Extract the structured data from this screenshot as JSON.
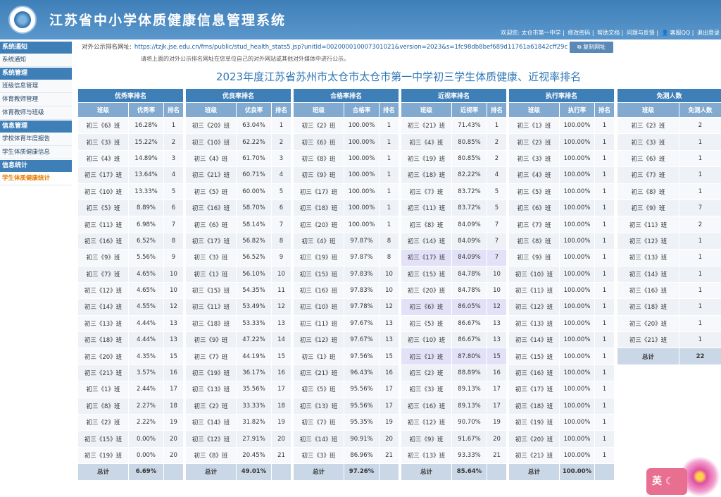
{
  "header": {
    "title": "江苏省中小学体质健康信息管理系统",
    "welcome": "欢迎您: 太仓市第一中学",
    "links": [
      "修改密码",
      "帮助文档",
      "问题与反馈",
      "客服QQ",
      "退出登录"
    ]
  },
  "sidebar": [
    {
      "section": "系统通知",
      "items": [
        "系统通知"
      ]
    },
    {
      "section": "系统管理",
      "items": [
        "班级信息管理",
        "体育教师管理",
        "体育教师与班级"
      ]
    },
    {
      "section": "信息管理",
      "items": [
        "学校体育年度报告",
        "学生体质健康信息"
      ]
    },
    {
      "section": "信息统计",
      "items": [
        "学生体质健康统计"
      ]
    }
  ],
  "active_item": "学生体质健康统计",
  "url_label": "对外公示排名网址:",
  "url": "https://tzjk.jse.edu.cn/fms/public/stud_health_stats5.jsp?unitId=00200001000730102​1&version=2023&s=1fc98db8bef689d11761a61842cff29c",
  "copy_button": "复制网址",
  "note": "请将上面的对外公示排名网址在您单位自己的对外网站或其他对外媒体中进行公示。",
  "page_title": "2023年度江苏省苏州市太仓市太仓市第一中学初三学生体质健康、近视率排名",
  "ime_label": "英",
  "tables": [
    {
      "caption": "优秀率排名",
      "cols": [
        "班级",
        "优秀率",
        "排名"
      ],
      "rows": [
        [
          "初三《6》班",
          "16.28%",
          "1"
        ],
        [
          "初三《3》班",
          "15.22%",
          "2"
        ],
        [
          "初三《4》班",
          "14.89%",
          "3"
        ],
        [
          "初三《17》班",
          "13.64%",
          "4"
        ],
        [
          "初三《10》班",
          "13.33%",
          "5"
        ],
        [
          "初三《5》班",
          "8.89%",
          "6"
        ],
        [
          "初三《11》班",
          "6.98%",
          "7"
        ],
        [
          "初三《16》班",
          "6.52%",
          "8"
        ],
        [
          "初三《9》班",
          "5.56%",
          "9"
        ],
        [
          "初三《7》班",
          "4.65%",
          "10"
        ],
        [
          "初三《12》班",
          "4.65%",
          "10"
        ],
        [
          "初三《14》班",
          "4.55%",
          "12"
        ],
        [
          "初三《13》班",
          "4.44%",
          "13"
        ],
        [
          "初三《18》班",
          "4.44%",
          "13"
        ],
        [
          "初三《20》班",
          "4.35%",
          "15"
        ],
        [
          "初三《21》班",
          "3.57%",
          "16"
        ],
        [
          "初三《1》班",
          "2.44%",
          "17"
        ],
        [
          "初三《8》班",
          "2.27%",
          "18"
        ],
        [
          "初三《2》班",
          "2.22%",
          "19"
        ],
        [
          "初三《15》班",
          "0.00%",
          "20"
        ],
        [
          "初三《19》班",
          "0.00%",
          "20"
        ]
      ],
      "total": [
        "总计",
        "6.69%",
        ""
      ]
    },
    {
      "caption": "优良率排名",
      "cols": [
        "班级",
        "优良率",
        "排名"
      ],
      "rows": [
        [
          "初三《20》班",
          "63.04%",
          "1"
        ],
        [
          "初三《10》班",
          "62.22%",
          "2"
        ],
        [
          "初三《4》班",
          "61.70%",
          "3"
        ],
        [
          "初三《21》班",
          "60.71%",
          "4"
        ],
        [
          "初三《5》班",
          "60.00%",
          "5"
        ],
        [
          "初三《16》班",
          "58.70%",
          "6"
        ],
        [
          "初三《6》班",
          "58.14%",
          "7"
        ],
        [
          "初三《17》班",
          "56.82%",
          "8"
        ],
        [
          "初三《3》班",
          "56.52%",
          "9"
        ],
        [
          "初三《1》班",
          "56.10%",
          "10"
        ],
        [
          "初三《15》班",
          "54.35%",
          "11"
        ],
        [
          "初三《11》班",
          "53.49%",
          "12"
        ],
        [
          "初三《18》班",
          "53.33%",
          "13"
        ],
        [
          "初三《9》班",
          "47.22%",
          "14"
        ],
        [
          "初三《7》班",
          "44.19%",
          "15"
        ],
        [
          "初三《19》班",
          "36.17%",
          "16"
        ],
        [
          "初三《13》班",
          "35.56%",
          "17"
        ],
        [
          "初三《2》班",
          "33.33%",
          "18"
        ],
        [
          "初三《14》班",
          "31.82%",
          "19"
        ],
        [
          "初三《12》班",
          "27.91%",
          "20"
        ],
        [
          "初三《8》班",
          "20.45%",
          "21"
        ]
      ],
      "total": [
        "总计",
        "49.01%",
        ""
      ]
    },
    {
      "caption": "合格率排名",
      "cols": [
        "班级",
        "合格率",
        "排名"
      ],
      "rows": [
        [
          "初三《2》班",
          "100.00%",
          "1"
        ],
        [
          "初三《6》班",
          "100.00%",
          "1"
        ],
        [
          "初三《8》班",
          "100.00%",
          "1"
        ],
        [
          "初三《9》班",
          "100.00%",
          "1"
        ],
        [
          "初三《17》班",
          "100.00%",
          "1"
        ],
        [
          "初三《18》班",
          "100.00%",
          "1"
        ],
        [
          "初三《20》班",
          "100.00%",
          "1"
        ],
        [
          "初三《4》班",
          "97.87%",
          "8"
        ],
        [
          "初三《19》班",
          "97.87%",
          "8"
        ],
        [
          "初三《15》班",
          "97.83%",
          "10"
        ],
        [
          "初三《16》班",
          "97.83%",
          "10"
        ],
        [
          "初三《10》班",
          "97.78%",
          "12"
        ],
        [
          "初三《11》班",
          "97.67%",
          "13"
        ],
        [
          "初三《12》班",
          "97.67%",
          "13"
        ],
        [
          "初三《1》班",
          "97.56%",
          "15"
        ],
        [
          "初三《21》班",
          "96.43%",
          "16"
        ],
        [
          "初三《5》班",
          "95.56%",
          "17"
        ],
        [
          "初三《13》班",
          "95.56%",
          "17"
        ],
        [
          "初三《7》班",
          "95.35%",
          "19"
        ],
        [
          "初三《14》班",
          "90.91%",
          "20"
        ],
        [
          "初三《3》班",
          "86.96%",
          "21"
        ]
      ],
      "total": [
        "总计",
        "97.26%",
        ""
      ]
    },
    {
      "caption": "近视率排名",
      "cols": [
        "班级",
        "近视率",
        "排名"
      ],
      "rows": [
        [
          "初三《21》班",
          "71.43%",
          "1"
        ],
        [
          "初三《4》班",
          "80.85%",
          "2"
        ],
        [
          "初三《19》班",
          "80.85%",
          "2"
        ],
        [
          "初三《18》班",
          "82.22%",
          "4"
        ],
        [
          "初三《7》班",
          "83.72%",
          "5"
        ],
        [
          "初三《11》班",
          "83.72%",
          "5"
        ],
        [
          "初三《8》班",
          "84.09%",
          "7"
        ],
        [
          "初三《14》班",
          "84.09%",
          "7"
        ],
        [
          "初三《17》班",
          "84.09%",
          "7"
        ],
        [
          "初三《15》班",
          "84.78%",
          "10"
        ],
        [
          "初三《20》班",
          "84.78%",
          "10"
        ],
        [
          "初三《6》班",
          "86.05%",
          "12"
        ],
        [
          "初三《5》班",
          "86.67%",
          "13"
        ],
        [
          "初三《10》班",
          "86.67%",
          "13"
        ],
        [
          "初三《1》班",
          "87.80%",
          "15"
        ],
        [
          "初三《2》班",
          "88.89%",
          "16"
        ],
        [
          "初三《3》班",
          "89.13%",
          "17"
        ],
        [
          "初三《16》班",
          "89.13%",
          "17"
        ],
        [
          "初三《12》班",
          "90.70%",
          "19"
        ],
        [
          "初三《9》班",
          "91.67%",
          "20"
        ],
        [
          "初三《13》班",
          "93.33%",
          "21"
        ]
      ],
      "highlight_rows": [
        8,
        11,
        14
      ],
      "total": [
        "总计",
        "85.64%",
        ""
      ]
    },
    {
      "caption": "执行率排名",
      "cols": [
        "班级",
        "执行率",
        "排名"
      ],
      "rows": [
        [
          "初三《1》班",
          "100.00%",
          "1"
        ],
        [
          "初三《2》班",
          "100.00%",
          "1"
        ],
        [
          "初三《3》班",
          "100.00%",
          "1"
        ],
        [
          "初三《4》班",
          "100.00%",
          "1"
        ],
        [
          "初三《5》班",
          "100.00%",
          "1"
        ],
        [
          "初三《6》班",
          "100.00%",
          "1"
        ],
        [
          "初三《7》班",
          "100.00%",
          "1"
        ],
        [
          "初三《8》班",
          "100.00%",
          "1"
        ],
        [
          "初三《9》班",
          "100.00%",
          "1"
        ],
        [
          "初三《10》班",
          "100.00%",
          "1"
        ],
        [
          "初三《11》班",
          "100.00%",
          "1"
        ],
        [
          "初三《12》班",
          "100.00%",
          "1"
        ],
        [
          "初三《13》班",
          "100.00%",
          "1"
        ],
        [
          "初三《14》班",
          "100.00%",
          "1"
        ],
        [
          "初三《15》班",
          "100.00%",
          "1"
        ],
        [
          "初三《16》班",
          "100.00%",
          "1"
        ],
        [
          "初三《17》班",
          "100.00%",
          "1"
        ],
        [
          "初三《18》班",
          "100.00%",
          "1"
        ],
        [
          "初三《19》班",
          "100.00%",
          "1"
        ],
        [
          "初三《20》班",
          "100.00%",
          "1"
        ],
        [
          "初三《21》班",
          "100.00%",
          "1"
        ]
      ],
      "total": [
        "总计",
        "100.00%",
        ""
      ]
    },
    {
      "caption": "免测人数",
      "cols": [
        "班级",
        "免测人数"
      ],
      "rows": [
        [
          "初三《2》班",
          "2"
        ],
        [
          "初三《3》班",
          "1"
        ],
        [
          "初三《6》班",
          "1"
        ],
        [
          "初三《7》班",
          "1"
        ],
        [
          "初三《8》班",
          "1"
        ],
        [
          "初三《9》班",
          "7"
        ],
        [
          "初三《11》班",
          "2"
        ],
        [
          "初三《12》班",
          "1"
        ],
        [
          "初三《13》班",
          "1"
        ],
        [
          "初三《14》班",
          "1"
        ],
        [
          "初三《16》班",
          "1"
        ],
        [
          "初三《18》班",
          "1"
        ],
        [
          "初三《20》班",
          "1"
        ],
        [
          "初三《21》班",
          "1"
        ]
      ],
      "total": [
        "总计",
        "22"
      ]
    }
  ]
}
